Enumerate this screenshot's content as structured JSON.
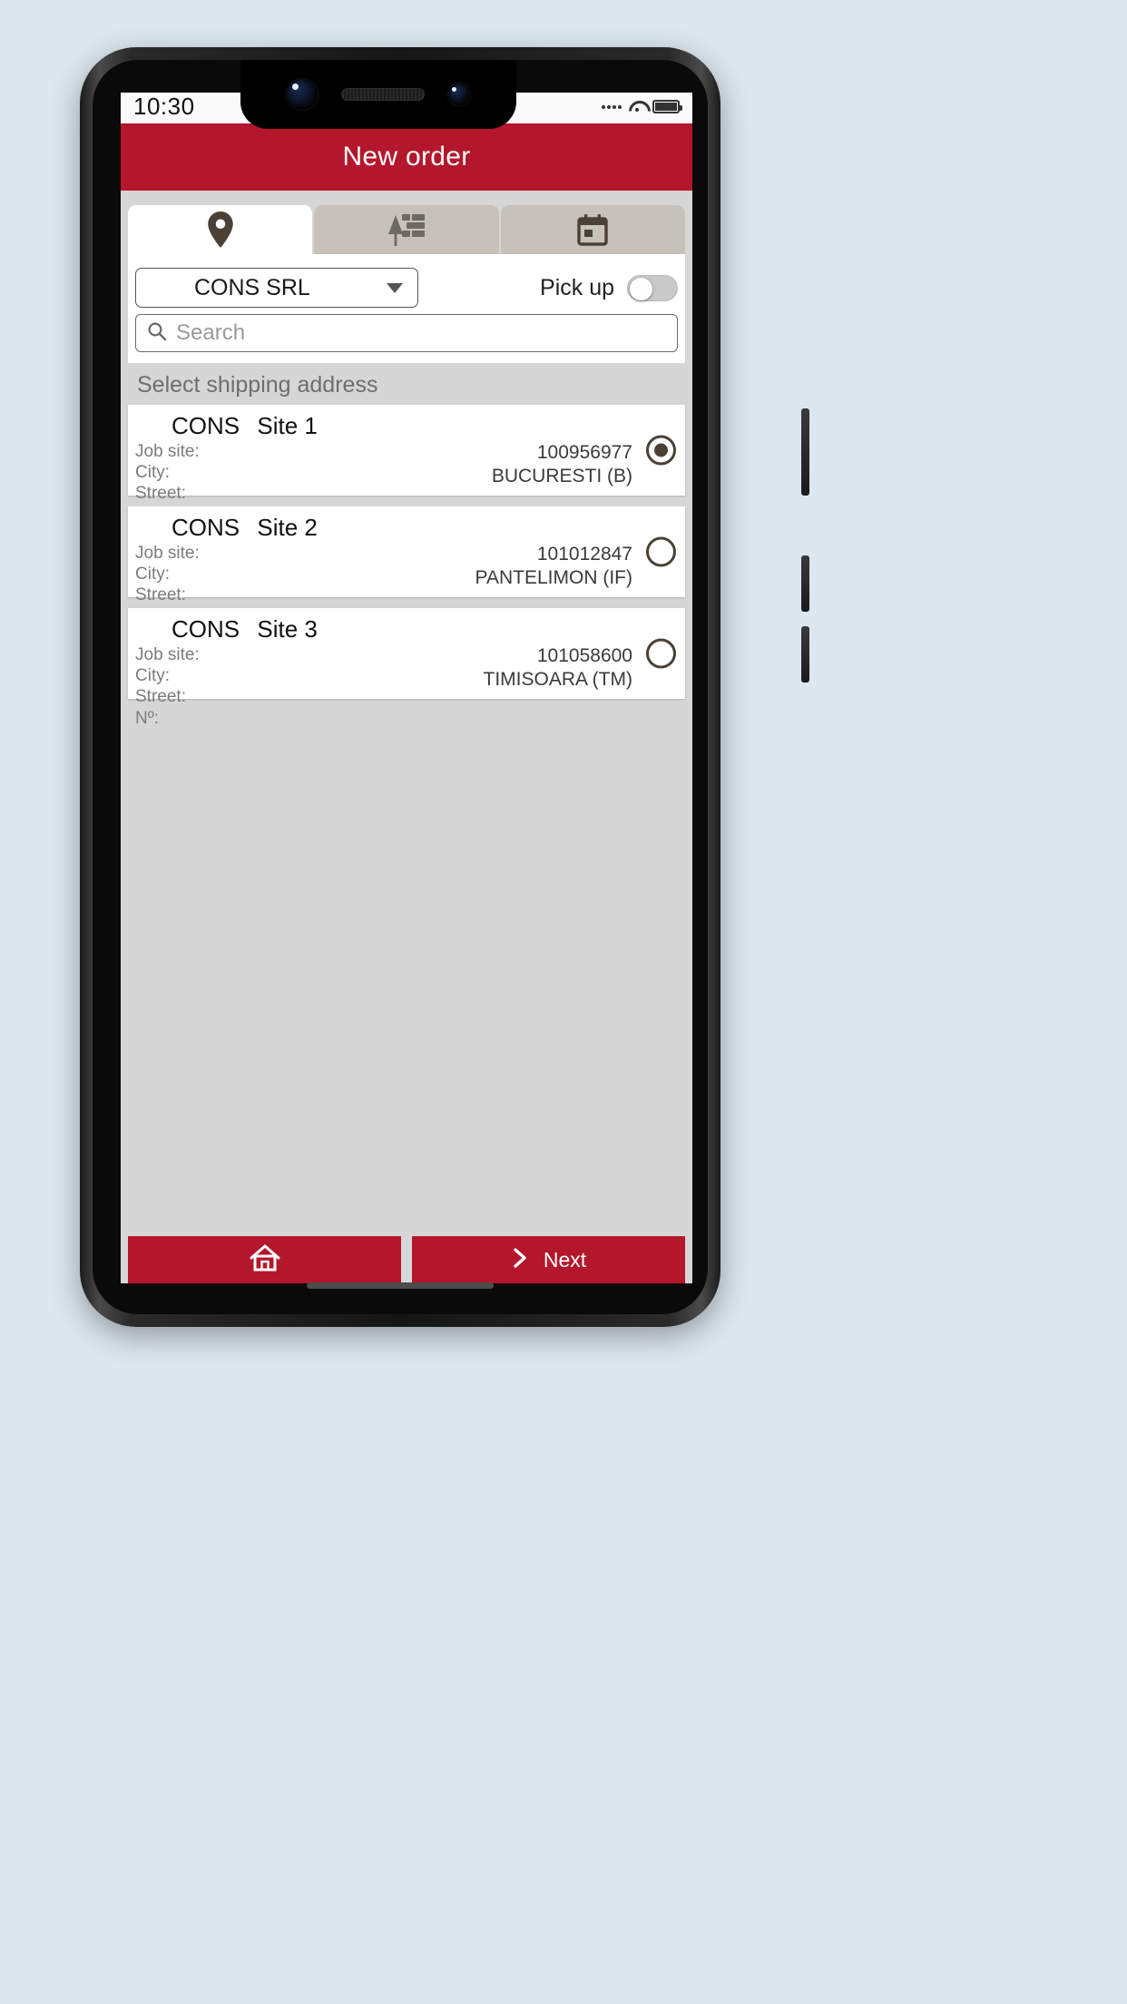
{
  "device": {
    "status_bar": {
      "time": "10:30",
      "icons": [
        "signal-dots-icon",
        "wifi-icon",
        "battery-icon"
      ]
    }
  },
  "header": {
    "title": "New order",
    "accent_color": "#b4172c"
  },
  "tabs": [
    {
      "name": "tab-delivery-address",
      "icon": "map-pin-icon",
      "active": true
    },
    {
      "name": "tab-products",
      "icon": "brick-wall-icon",
      "active": false
    },
    {
      "name": "tab-date",
      "icon": "calendar-icon",
      "active": false
    }
  ],
  "form": {
    "company": {
      "label": "CONS SRL",
      "dropdown_icon": "chevron-down-icon"
    },
    "pickup": {
      "label": "Pick up",
      "enabled": false
    },
    "search": {
      "placeholder": "Search",
      "value": "",
      "icon": "search-icon"
    }
  },
  "list": {
    "section_title": "Select shipping address",
    "row_labels": [
      "Job site:",
      "City:",
      "Street:",
      "Nº:"
    ],
    "items": [
      {
        "company": "CONS",
        "site": "Site 1",
        "job_site": "100956977",
        "city": "BUCURESTI (B)",
        "street": "",
        "number": "",
        "selected": true
      },
      {
        "company": "CONS",
        "site": "Site 2",
        "job_site": "101012847",
        "city": "PANTELIMON (IF)",
        "street": "",
        "number": "",
        "selected": false
      },
      {
        "company": "CONS",
        "site": "Site 3",
        "job_site": "101058600",
        "city": "TIMISOARA (TM)",
        "street": "",
        "number": "",
        "selected": false
      }
    ]
  },
  "footer": {
    "home_button": {
      "label": "",
      "icon": "home-icon"
    },
    "next_button": {
      "label": "Next",
      "icon": "chevron-right-icon"
    }
  }
}
